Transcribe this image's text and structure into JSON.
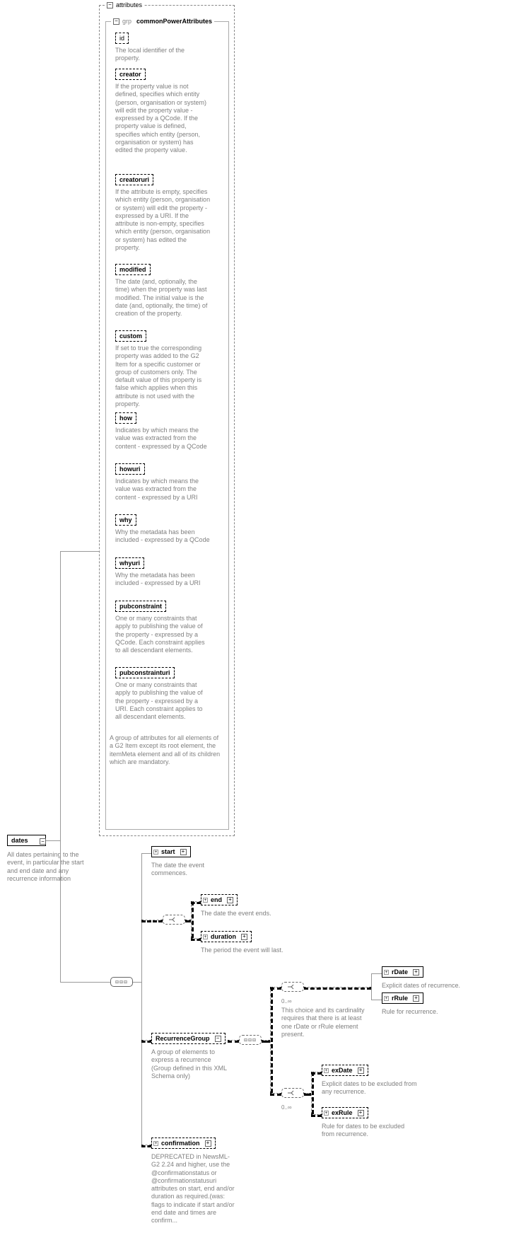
{
  "root": {
    "label": "dates",
    "desc": "All dates pertaining to the event, in particular the start and end date and any recurrence information"
  },
  "attributes_box": "attributes",
  "grp": {
    "prefix": "grp",
    "label": "commonPowerAttributes",
    "desc": "A group of attributes for all elements of a G2 Item except its root element, the itemMeta element and all of its children which are mandatory.",
    "items": [
      {
        "label": "id",
        "desc": "The local identifier of the property."
      },
      {
        "label": "creator",
        "desc": "If the property value is not defined, specifies which entity (person, organisation or system) will edit the property value - expressed by a QCode. If the property value is defined, specifies which entity (person, organisation or system) has edited the property value."
      },
      {
        "label": "creatoruri",
        "desc": "If the attribute is empty, specifies which entity (person, organisation or system) will edit the property - expressed by a URI. If the attribute is non-empty, specifies which entity (person, organisation or system) has edited the property."
      },
      {
        "label": "modified",
        "desc": "The date (and, optionally, the time) when the property was last modified. The initial value is the date (and, optionally, the time) of creation of the property."
      },
      {
        "label": "custom",
        "desc": "If set to true the corresponding property was added to the G2 Item for a specific customer or group of customers only. The default value of this property is false which applies when this attribute is not used with the property."
      },
      {
        "label": "how",
        "desc": "Indicates by which means the value was extracted from the content - expressed by a QCode"
      },
      {
        "label": "howuri",
        "desc": "Indicates by which means the value was extracted from the content - expressed by a URI"
      },
      {
        "label": "why",
        "desc": "Why the metadata has been included - expressed by a QCode"
      },
      {
        "label": "whyuri",
        "desc": "Why the metadata has been included - expressed by a URI"
      },
      {
        "label": "pubconstraint",
        "desc": "One or many constraints that apply to publishing the value of the property - expressed by a QCode. Each constraint applies to all descendant elements."
      },
      {
        "label": "pubconstrainturi",
        "desc": "One or many constraints that apply to publishing the value of the property - expressed by a URI. Each constraint applies to all descendant elements."
      }
    ]
  },
  "children": {
    "start": {
      "label": "start",
      "desc": "The date the event commences."
    },
    "end": {
      "label": "end",
      "desc": "The date the event ends."
    },
    "duration": {
      "label": "duration",
      "desc": "The period the event will last."
    },
    "recurrence": {
      "label": "RecurrenceGroup",
      "desc": "A group of elements to express a recurrence (Group defined in this XML Schema only)"
    },
    "choice_desc": "This choice and its cardinality requires that there is at least one rDate or rRule element present.",
    "rdate": {
      "label": "rDate",
      "desc": "Explicit dates of recurrence."
    },
    "rrule": {
      "label": "rRule",
      "desc": "Rule for recurrence."
    },
    "exdate": {
      "label": "exDate",
      "desc": "Explicit dates to be excluded from any recurrence."
    },
    "exrule": {
      "label": "exRule",
      "desc": "Rule for dates to be excluded from recurrence."
    },
    "confirmation": {
      "label": "confirmation",
      "desc": "DEPRECATED in NewsML-G2 2.24 and higher, use the @confirmationstatus or @confirmationstatusuri attributes on start, end and/or duration as required.(was: flags to indicate if start and/or end date and times are confirm..."
    },
    "card": "0..∞"
  }
}
